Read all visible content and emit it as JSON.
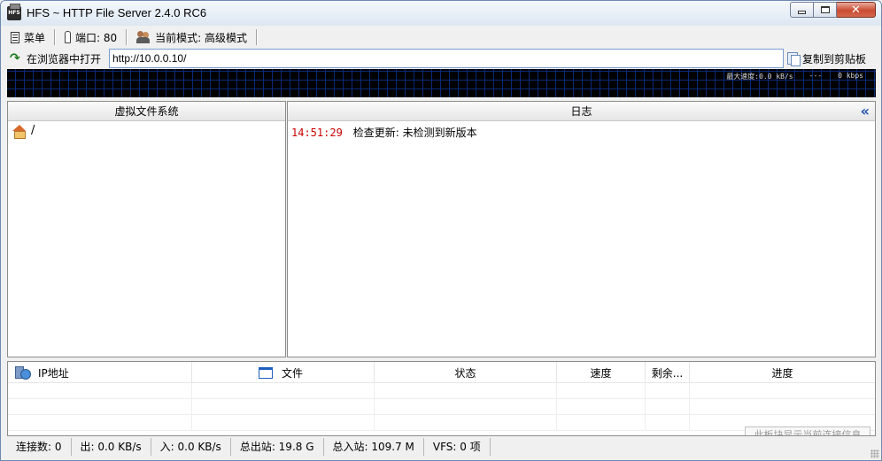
{
  "window": {
    "title": "HFS ~ HTTP File Server 2.4.0 RC6"
  },
  "toolbar": {
    "menu_label": "菜单",
    "port_label": "端口: 80",
    "mode_label": "当前模式: 高级模式"
  },
  "url_bar": {
    "open_label": "在浏览器中打开",
    "url_value": "http://10.0.0.10/",
    "copy_label": "复制到剪贴板"
  },
  "graph": {
    "max_speed": "最大速度:0.0 kB/s",
    "dashes": "---",
    "rate": "0 kbps"
  },
  "vfs": {
    "header": "虚拟文件系统",
    "root": "/"
  },
  "log": {
    "header": "日志",
    "entries": [
      {
        "time": "14:51:29",
        "message": "检查更新: 未检测到新版本"
      }
    ]
  },
  "connections": {
    "columns": {
      "ip": "IP地址",
      "file": "文件",
      "status": "状态",
      "speed": "速度",
      "remaining": "剩余...",
      "progress": "进度"
    },
    "empty_message": "此板块显示当前连接信息"
  },
  "statusbar": {
    "connections": "连接数: 0",
    "out": "出: 0.0 KB/s",
    "in": "入: 0.0 KB/s",
    "total_out": "总出站: 19.8 G",
    "total_in": "总入站: 109.7 M",
    "vfs": "VFS: 0 项"
  }
}
